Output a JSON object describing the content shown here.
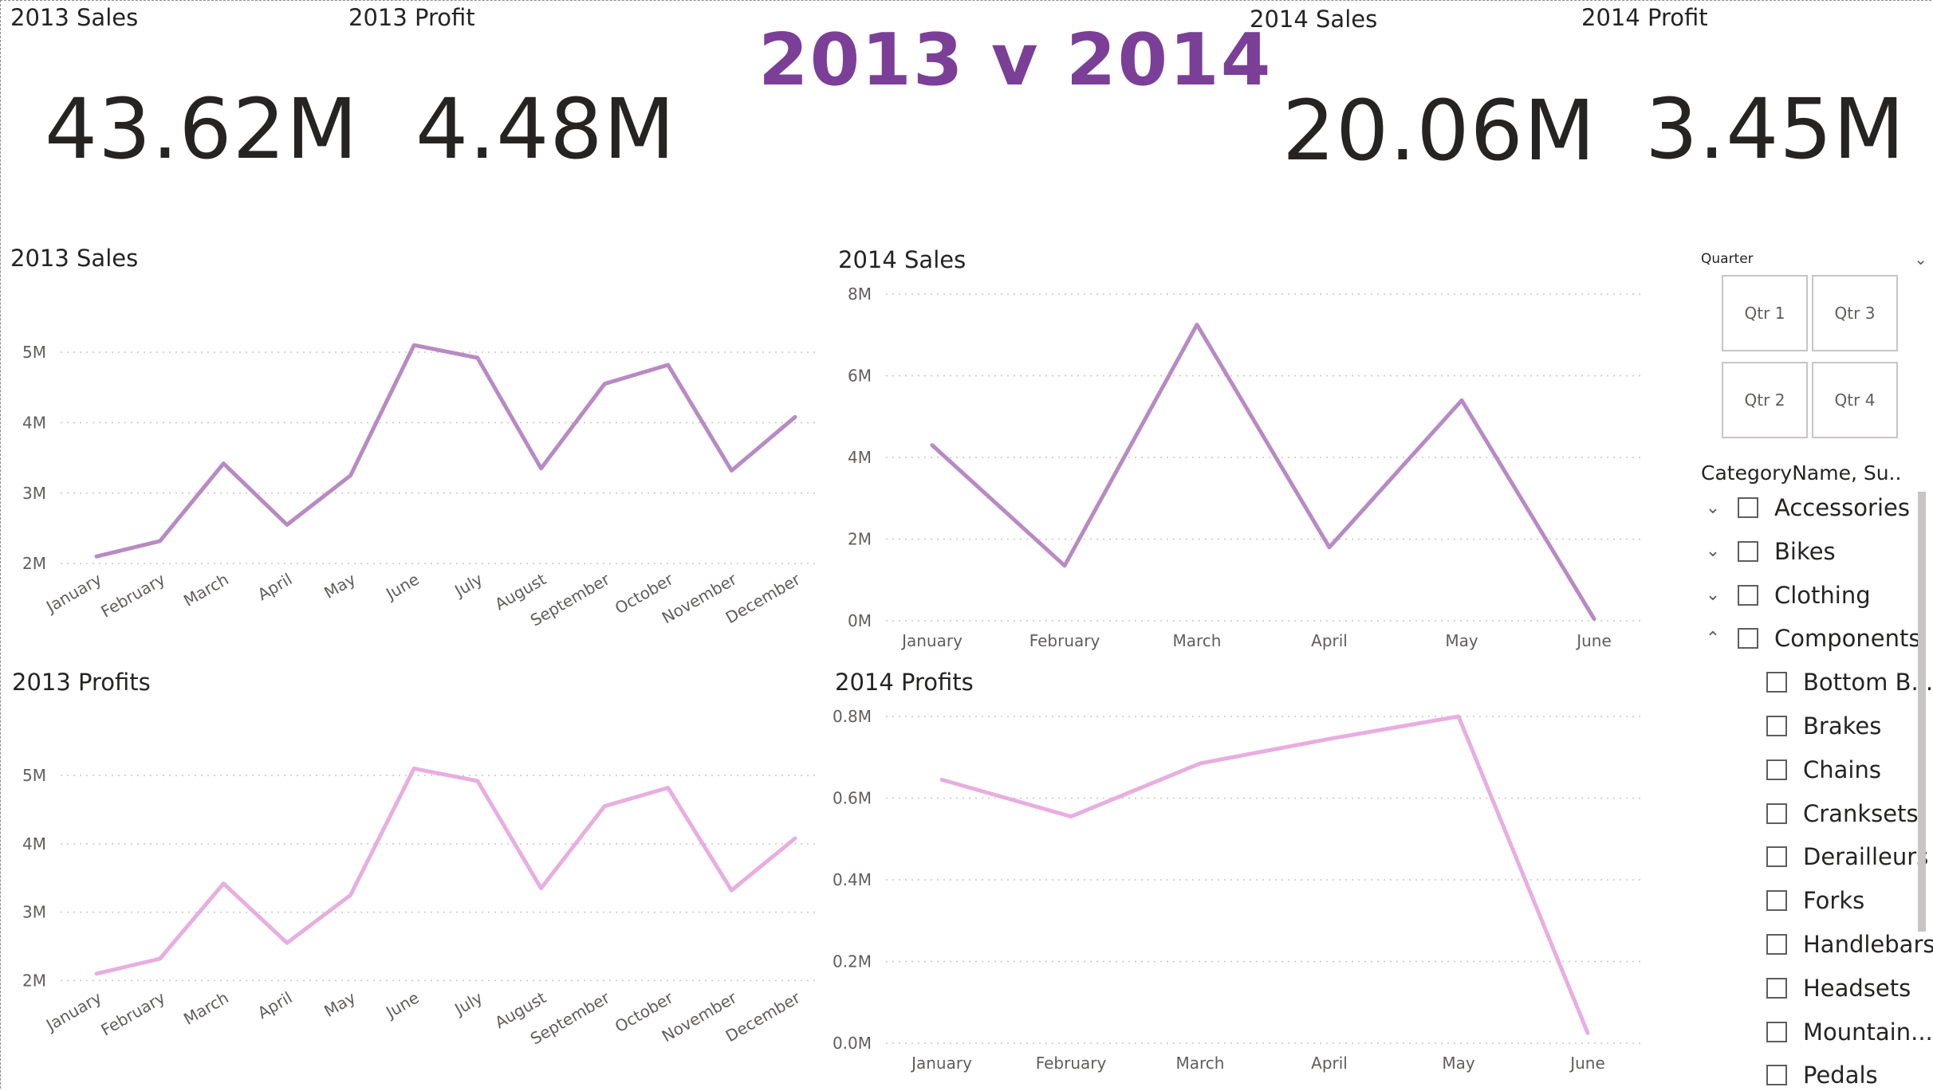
{
  "cards": {
    "sales_2013": {
      "label": "2013 Sales",
      "value": "43.62M"
    },
    "profit_2013": {
      "label": "2013 Profit",
      "value": "4.48M"
    },
    "sales_2014": {
      "label": "2014 Sales",
      "value": "20.06M"
    },
    "profit_2014": {
      "label": "2014 Profit",
      "value": "3.45M"
    }
  },
  "main_title": "2013 v 2014",
  "colors": {
    "title": "#7b3f98",
    "sales_line": "#b88ac4",
    "profit_line": "#e8aee0"
  },
  "chart_data": [
    {
      "id": "sales2013",
      "type": "line",
      "title": "2013 Sales",
      "categories": [
        "January",
        "February",
        "March",
        "April",
        "May",
        "June",
        "July",
        "August",
        "September",
        "October",
        "November",
        "December"
      ],
      "series": [
        {
          "values": [
            2.1,
            2.32,
            3.42,
            2.55,
            3.25,
            5.1,
            4.92,
            3.35,
            4.55,
            4.82,
            3.32,
            4.08
          ]
        }
      ],
      "yticks": [
        2,
        3,
        4,
        5
      ],
      "ytick_labels": [
        "2M",
        "3M",
        "4M",
        "5M"
      ],
      "ylim": [
        1.9,
        5.35
      ],
      "grid": true,
      "x_label_rotation": -30
    },
    {
      "id": "sales2014",
      "type": "line",
      "title": "2014 Sales",
      "categories": [
        "January",
        "February",
        "March",
        "April",
        "May",
        "June"
      ],
      "series": [
        {
          "values": [
            4.3,
            1.35,
            7.25,
            1.8,
            5.4,
            0.05
          ]
        }
      ],
      "yticks": [
        0,
        2,
        4,
        6,
        8
      ],
      "ytick_labels": [
        "0M",
        "2M",
        "4M",
        "6M",
        "8M"
      ],
      "ylim": [
        0,
        8
      ],
      "grid": true,
      "x_label_rotation": 0
    },
    {
      "id": "profits2013",
      "type": "line",
      "title": "2013 Profits",
      "categories": [
        "January",
        "February",
        "March",
        "April",
        "May",
        "June",
        "July",
        "August",
        "September",
        "October",
        "November",
        "December"
      ],
      "series": [
        {
          "values": [
            2.1,
            2.32,
            3.42,
            2.55,
            3.25,
            5.1,
            4.92,
            3.35,
            4.55,
            4.82,
            3.32,
            4.08
          ]
        }
      ],
      "yticks": [
        2,
        3,
        4,
        5
      ],
      "ytick_labels": [
        "2M",
        "3M",
        "4M",
        "5M"
      ],
      "ylim": [
        1.9,
        5.35
      ],
      "grid": true,
      "x_label_rotation": -30
    },
    {
      "id": "profits2014",
      "type": "line",
      "title": "2014 Profits",
      "categories": [
        "January",
        "February",
        "March",
        "April",
        "May",
        "June"
      ],
      "series": [
        {
          "values": [
            0.645,
            0.555,
            0.685,
            0.745,
            0.8,
            0.025
          ]
        }
      ],
      "yticks": [
        0,
        0.2,
        0.4,
        0.6,
        0.8
      ],
      "ytick_labels": [
        "0.0M",
        "0.2M",
        "0.4M",
        "0.6M",
        "0.8M"
      ],
      "ylim": [
        0,
        0.8
      ],
      "grid": true,
      "x_label_rotation": 0
    }
  ],
  "quarter_slicer": {
    "header": "Quarter",
    "buttons": [
      "Qtr 1",
      "Qtr 3",
      "Qtr 2",
      "Qtr 4"
    ]
  },
  "category_slicer": {
    "header": "CategoryName, Su...",
    "items": [
      {
        "label": "Accessories",
        "level": 0,
        "expander": "collapsed"
      },
      {
        "label": "Bikes",
        "level": 0,
        "expander": "collapsed"
      },
      {
        "label": "Clothing",
        "level": 0,
        "expander": "collapsed"
      },
      {
        "label": "Components",
        "level": 0,
        "expander": "expanded"
      },
      {
        "label": "Bottom B...",
        "level": 1
      },
      {
        "label": "Brakes",
        "level": 1
      },
      {
        "label": "Chains",
        "level": 1
      },
      {
        "label": "Cranksets",
        "level": 1
      },
      {
        "label": "Derailleurs",
        "level": 1
      },
      {
        "label": "Forks",
        "level": 1
      },
      {
        "label": "Handlebars",
        "level": 1
      },
      {
        "label": "Headsets",
        "level": 1
      },
      {
        "label": "Mountain...",
        "level": 1
      },
      {
        "label": "Pedals",
        "level": 1
      }
    ]
  }
}
